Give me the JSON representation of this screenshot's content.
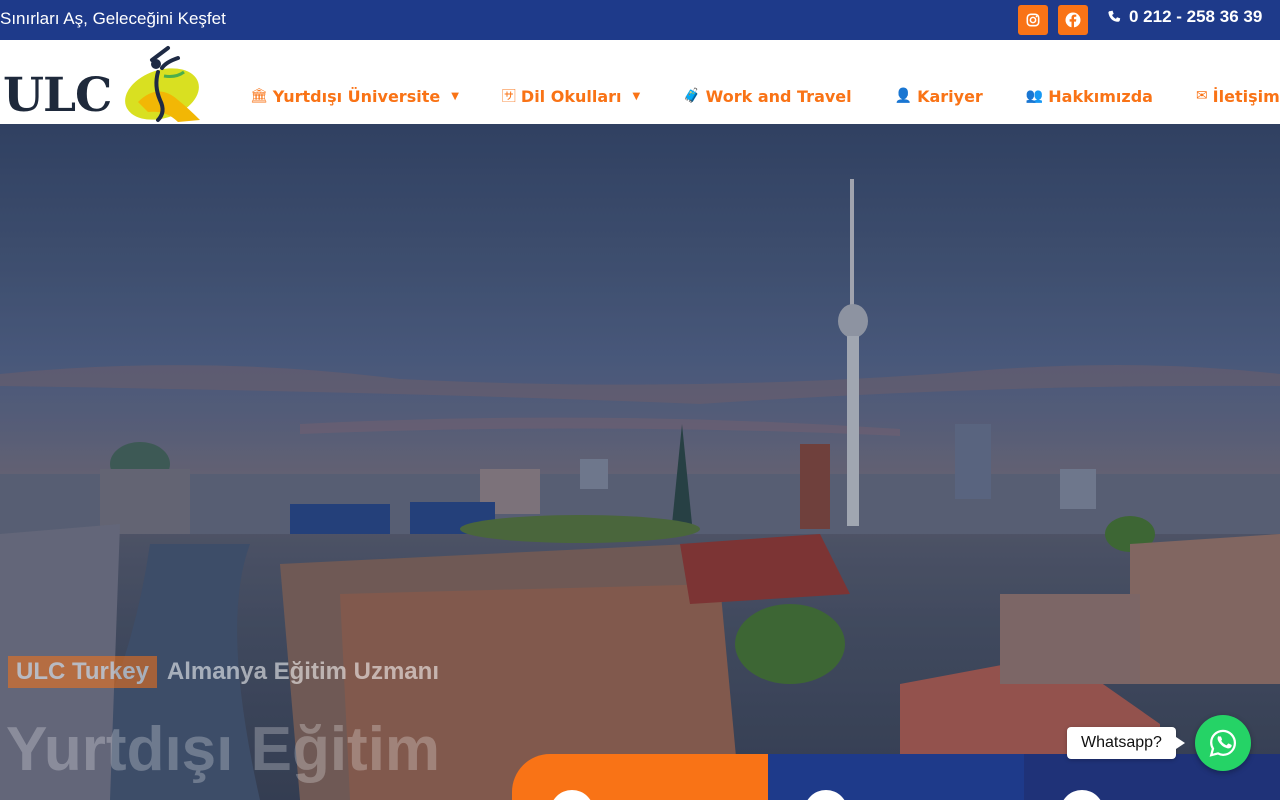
{
  "topbar": {
    "slogan": "Sınırları Aş, Geleceğini Keşfet",
    "phone": "0 212 - 258 36 39",
    "social": [
      "instagram-icon",
      "facebook-icon"
    ]
  },
  "header": {
    "logo_text": "ULC"
  },
  "nav": {
    "items": [
      {
        "label": "Yurtdışı Üniversite",
        "icon": "building-icon",
        "dropdown": true
      },
      {
        "label": "Dil Okulları",
        "icon": "language-icon",
        "dropdown": true
      },
      {
        "label": "Work and Travel",
        "icon": "luggage-icon",
        "dropdown": false
      },
      {
        "label": "Kariyer",
        "icon": "person-icon",
        "dropdown": false
      },
      {
        "label": "Hakkımızda",
        "icon": "group-icon",
        "dropdown": false
      },
      {
        "label": "İletişim",
        "icon": "envelope-icon",
        "dropdown": false
      }
    ]
  },
  "hero": {
    "badge": "ULC Turkey",
    "subtitle": "Almanya Eğitim Uzmanı",
    "title": "Yurtdışı Eğitim"
  },
  "whatsapp": {
    "label": "Whatsapp?"
  },
  "colors": {
    "brand_blue": "#1e3a8a",
    "accent_orange": "#f97316",
    "whatsapp_green": "#25d366"
  }
}
